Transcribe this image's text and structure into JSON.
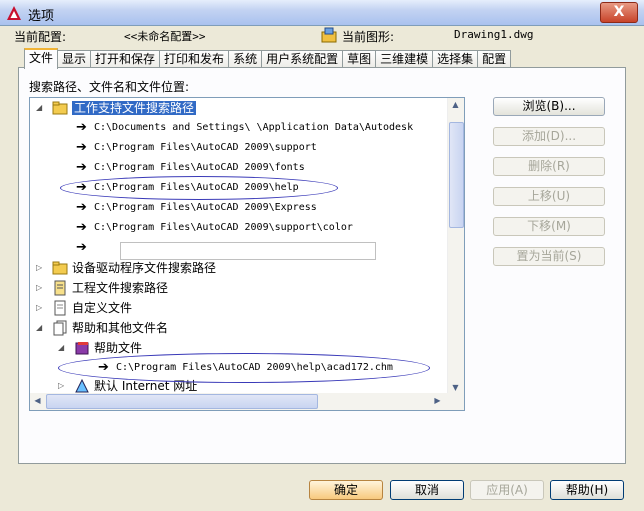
{
  "window": {
    "title": "选项",
    "close_label": "X"
  },
  "config": {
    "current_config_label": "当前配置:",
    "current_config_value": "<<未命名配置>>",
    "current_drawing_label": "当前图形:",
    "current_drawing_value": "Drawing1.dwg"
  },
  "tabs": [
    "文件",
    "显示",
    "打开和保存",
    "打印和发布",
    "系统",
    "用户系统配置",
    "草图",
    "三维建模",
    "选择集",
    "配置"
  ],
  "active_tab": 0,
  "panel": {
    "section_label": "搜索路径、文件名和文件位置:"
  },
  "tree": {
    "support_root": "工作支持文件搜索路径",
    "support_paths": [
      "C:\\Documents and Settings\\        \\Application Data\\Autodesk",
      "C:\\Program Files\\AutoCAD 2009\\support",
      "C:\\Program Files\\AutoCAD 2009\\fonts",
      "C:\\Program Files\\AutoCAD 2009\\help",
      "C:\\Program Files\\AutoCAD 2009\\Express",
      "C:\\Program Files\\AutoCAD 2009\\support\\color"
    ],
    "device_driver": "设备驱动程序文件搜索路径",
    "project_files": "工程文件搜索路径",
    "custom_files": "自定义文件",
    "help_misc": "帮助和其他文件名",
    "help_file": "帮助文件",
    "help_file_path": "C:\\Program Files\\AutoCAD 2009\\help\\acad172.chm",
    "default_internet": "默认 Internet 网址"
  },
  "side_buttons": [
    {
      "label": "浏览(B)...",
      "disabled": false
    },
    {
      "label": "添加(D)...",
      "disabled": true
    },
    {
      "label": "删除(R)",
      "disabled": true
    },
    {
      "label": "上移(U)",
      "disabled": true
    },
    {
      "label": "下移(M)",
      "disabled": true
    },
    {
      "label": "置为当前(S)",
      "disabled": true
    }
  ],
  "bottom_buttons": {
    "ok": "确定",
    "cancel": "取消",
    "apply": "应用(A)",
    "help": "帮助(H)"
  },
  "colors": {
    "selection": "#316ac5",
    "annotation_ellipse": "#3a3ab8"
  }
}
